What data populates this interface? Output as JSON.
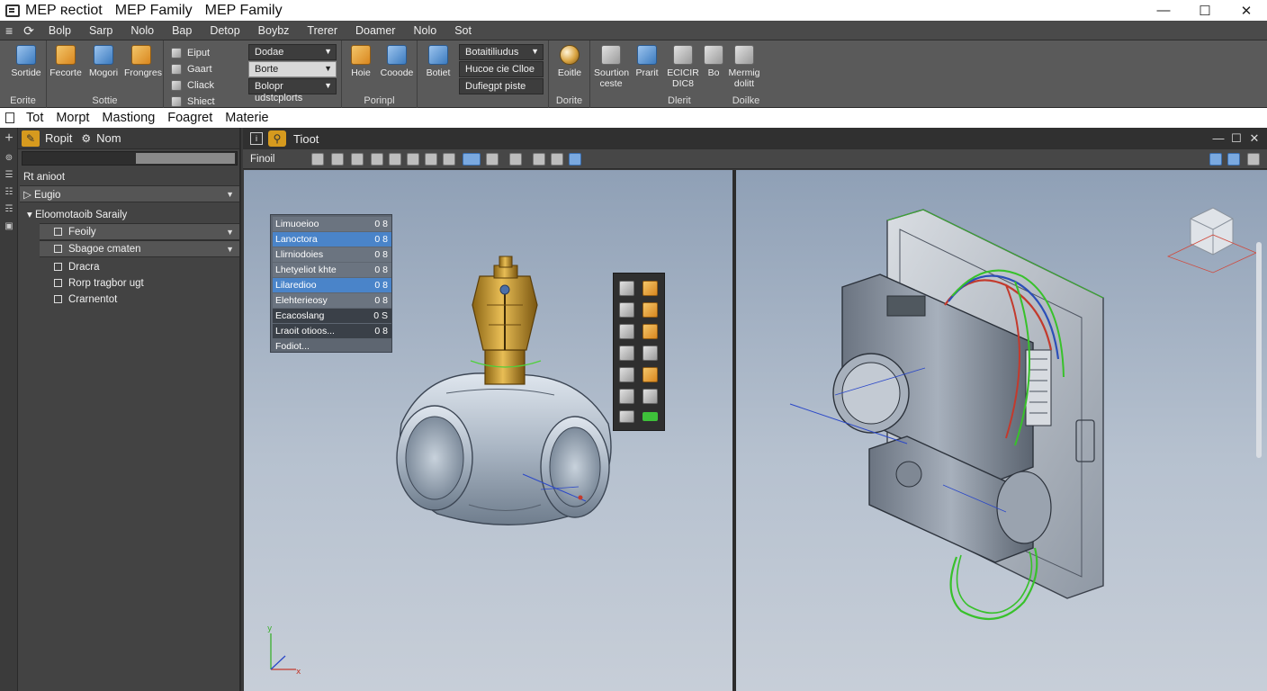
{
  "window": {
    "title_primary": "MEP ʀectiot",
    "title_secondary": "MEP Family",
    "title_tertiary": "MEP Family",
    "minimize": "—",
    "maximize": "☐",
    "close": "✕"
  },
  "ribbon_tabs": [
    "Bolp",
    "Sarp",
    "Nolo",
    "Bap",
    "Detop",
    "Boybz",
    "Trerer",
    "Doamer",
    "Nolo",
    "Sot"
  ],
  "ribbon": {
    "group1": {
      "title": "Eorite",
      "buttons": [
        "Sortide"
      ]
    },
    "group2": {
      "title": "Sottie",
      "buttons": [
        "Fecorte",
        "Mogori",
        "Frongres"
      ]
    },
    "group3": {
      "rows": [
        "Eiput",
        "Gaart",
        "Cliack",
        "Shiect"
      ],
      "combos": [
        "Dodae",
        "Borte",
        "Bolopr udstcplorts"
      ]
    },
    "group4": {
      "title": "Porinpl",
      "buttons": [
        "Hoie",
        "Cooode"
      ]
    },
    "group5": {
      "buttons": [
        "Botiet"
      ],
      "combos": [
        "Botaitiliudus",
        "Hucoe cie Clloe",
        "Dufiegpt piste"
      ]
    },
    "group6": {
      "title": "Dorite",
      "buttons": [
        "Eoitle"
      ]
    },
    "group7": {
      "title": "Dlerit",
      "buttons": [
        "Sourtion ceste",
        "Prarit",
        "ECICIR DIC8",
        "Bo",
        "Mermig dolitt"
      ]
    },
    "group8": {
      "title": "Doilke"
    }
  },
  "menu": [
    "Tot",
    "Morpt",
    "Mastiong",
    "Foagret",
    "Materie"
  ],
  "left_strip": [
    "⊚",
    "☰",
    "☷",
    "☶",
    "▣"
  ],
  "panel": {
    "tabs": [
      "Ropit",
      "Nom"
    ],
    "add": "+",
    "rows": [
      {
        "label": "Rt anioot",
        "type": "plain"
      },
      {
        "label": "▷ Eugio",
        "type": "band"
      },
      {
        "label": "▾  Eloomotaoib Saraily",
        "type": "plain"
      },
      {
        "label": "Feoily",
        "type": "band"
      },
      {
        "label": "Sbagoe cmaten",
        "type": "band"
      },
      {
        "label": "Dracra",
        "type": "plain"
      },
      {
        "label": "Rorp tragbor ugt",
        "type": "plain"
      },
      {
        "label": "Crarnentot",
        "type": "plain"
      }
    ]
  },
  "workspace": {
    "tab_title": "Tioot",
    "finish_label": "Finoil",
    "window_controls": [
      "—",
      "☐",
      "✕"
    ]
  },
  "property_list": [
    {
      "label": "Limuoeioo",
      "value": "0 8"
    },
    {
      "label": "Lanoctora",
      "value": "0 8"
    },
    {
      "label": "Llirniodoies",
      "value": "0 8"
    },
    {
      "label": "Lhetyeliot khte",
      "value": "0 8"
    },
    {
      "label": "Lilaredioo",
      "value": "0 8"
    },
    {
      "label": "Elehterieosy",
      "value": "0 8"
    },
    {
      "label": "Ecacoslang",
      "value": "0 S"
    },
    {
      "label": "Lraoit otioos...",
      "value": "0 8"
    },
    {
      "label": "Fodiot...",
      "value": ""
    }
  ],
  "colors": {
    "accent": "#d69a1e",
    "selection": "#4a84c9",
    "brass": "#c9962a",
    "wire_green": "#38c12b",
    "wire_red": "#c33a2d",
    "wire_blue": "#2c4fb8"
  }
}
